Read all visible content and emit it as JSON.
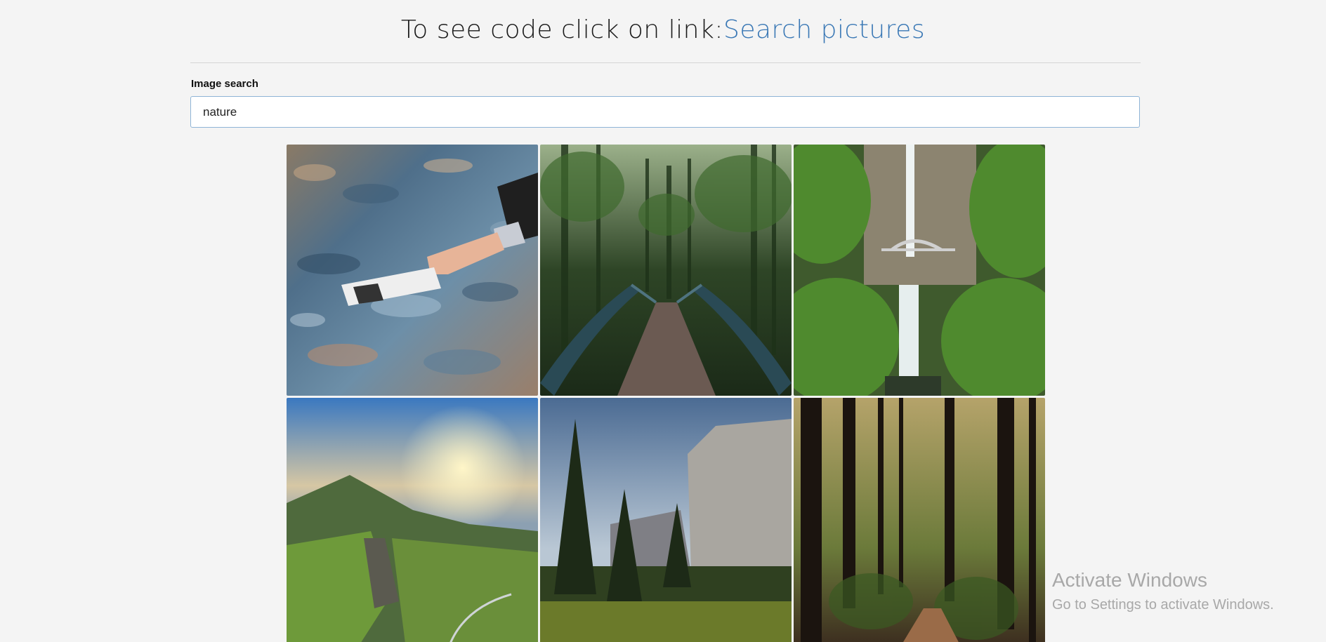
{
  "header": {
    "prefix": "To see code click on link:",
    "link_text": "Search pictures",
    "link_color": "#3a78b5"
  },
  "search": {
    "label": "Image search",
    "value": "nature"
  },
  "results": [
    {
      "subject": "hand-with-carton-over-river-rocks"
    },
    {
      "subject": "forest-footbridge"
    },
    {
      "subject": "waterfall-with-bridge"
    },
    {
      "subject": "green-valley-sunset"
    },
    {
      "subject": "granite-cliff-and-pines"
    },
    {
      "subject": "forest-path"
    }
  ],
  "watermark": {
    "title": "Activate Windows",
    "subtitle": "Go to Settings to activate Windows."
  }
}
